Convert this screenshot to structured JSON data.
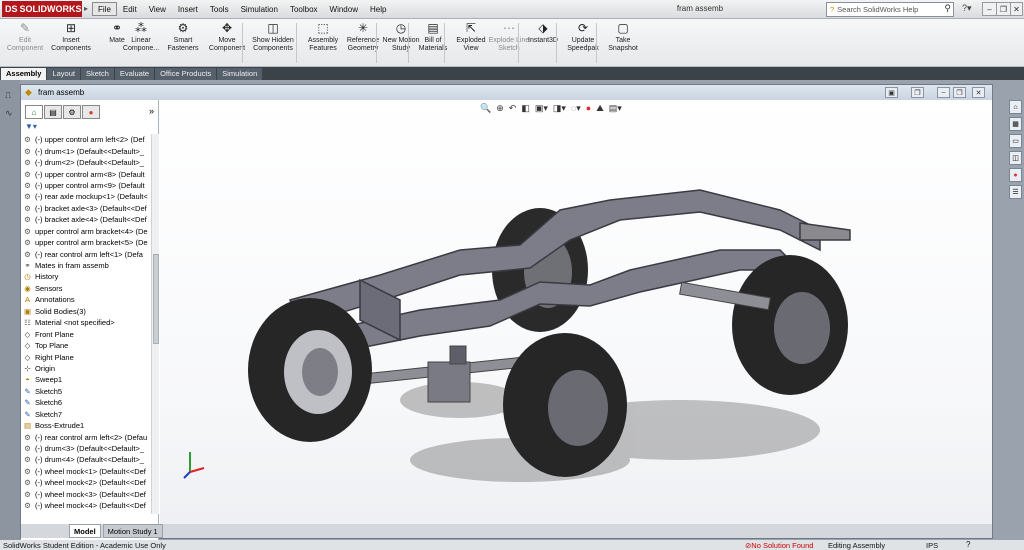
{
  "app": {
    "logo_text": "SOLIDWORKS",
    "logo_mark": "DS",
    "doc_title": "fram assemb"
  },
  "menu": [
    "File",
    "Edit",
    "View",
    "Insert",
    "Tools",
    "Simulation",
    "Toolbox",
    "Window",
    "Help"
  ],
  "search": {
    "placeholder": "Search SolidWorks Help"
  },
  "ribbon": [
    {
      "label": "Edit Component",
      "icon": "edit-component-icon",
      "disabled": true
    },
    {
      "label": "Insert Components",
      "icon": "insert-components-icon",
      "disabled": false
    },
    {
      "label": "Mate",
      "icon": "mate-icon",
      "disabled": false
    },
    {
      "label": "Linear Compone...",
      "icon": "linear-pattern-icon",
      "disabled": false
    },
    {
      "label": "Smart Fasteners",
      "icon": "smart-fasteners-icon",
      "disabled": false
    },
    {
      "label": "Move Component",
      "icon": "move-component-icon",
      "disabled": false
    },
    {
      "label": "Show Hidden Components",
      "icon": "show-hidden-icon",
      "disabled": false
    },
    {
      "label": "Assembly Features",
      "icon": "assembly-features-icon",
      "disabled": false
    },
    {
      "label": "Reference Geometry",
      "icon": "reference-geometry-icon",
      "disabled": false
    },
    {
      "label": "New Motion Study",
      "icon": "motion-study-icon",
      "disabled": false
    },
    {
      "label": "Bill of Materials",
      "icon": "bill-of-materials-icon",
      "disabled": false
    },
    {
      "label": "Exploded View",
      "icon": "exploded-view-icon",
      "disabled": false
    },
    {
      "label": "Explode Line Sketch",
      "icon": "explode-line-icon",
      "disabled": true
    },
    {
      "label": "Instant3D",
      "icon": "instant3d-icon",
      "disabled": false
    },
    {
      "label": "Update Speedpak",
      "icon": "speedpak-icon",
      "disabled": false
    },
    {
      "label": "Take Snapshot",
      "icon": "snapshot-icon",
      "disabled": false
    }
  ],
  "command_tabs": [
    "Assembly",
    "Layout",
    "Sketch",
    "Evaluate",
    "Office Products",
    "Simulation"
  ],
  "tree_items": [
    {
      "icon": "part-icon",
      "label": "(-) upper control arm left<2> (Def"
    },
    {
      "icon": "part-icon",
      "label": "(-) drum<1> (Default<<Default>_"
    },
    {
      "icon": "part-icon",
      "label": "(-) drum<2> (Default<<Default>_"
    },
    {
      "icon": "part-icon",
      "label": "(-) upper control arm<8> (Default"
    },
    {
      "icon": "part-icon",
      "label": "(-) upper control arm<9> (Default"
    },
    {
      "icon": "part-icon",
      "label": "(-) rear axle mockup<1> (Default<"
    },
    {
      "icon": "part-icon",
      "label": "(-) bracket axle<3> (Default<<Def"
    },
    {
      "icon": "part-icon",
      "label": "(-) bracket axle<4> (Default<<Def"
    },
    {
      "icon": "part-icon",
      "label": "upper control arm bracket<4> (De"
    },
    {
      "icon": "part-icon",
      "label": "upper control arm bracket<5> (De"
    },
    {
      "icon": "part-icon",
      "label": "(-) rear control arm left<1> (Defa"
    },
    {
      "icon": "mates-icon",
      "label": "Mates in fram assemb"
    },
    {
      "icon": "history-icon",
      "label": "History"
    },
    {
      "icon": "sensors-icon",
      "label": "Sensors"
    },
    {
      "icon": "annotations-icon",
      "label": "Annotations"
    },
    {
      "icon": "solid-bodies-icon",
      "label": "Solid Bodies(3)"
    },
    {
      "icon": "material-icon",
      "label": "Material <not specified>"
    },
    {
      "icon": "plane-icon",
      "label": "Front Plane"
    },
    {
      "icon": "plane-icon",
      "label": "Top Plane"
    },
    {
      "icon": "plane-icon",
      "label": "Right Plane"
    },
    {
      "icon": "origin-icon",
      "label": "Origin"
    },
    {
      "icon": "sweep-icon",
      "label": "Sweep1"
    },
    {
      "icon": "sketch-icon",
      "label": "Sketch5"
    },
    {
      "icon": "sketch-icon",
      "label": "Sketch6"
    },
    {
      "icon": "sketch-icon",
      "label": "Sketch7"
    },
    {
      "icon": "extrude-icon",
      "label": "Boss-Extrude1"
    },
    {
      "icon": "part-icon",
      "label": "(-) rear control arm left<2> (Defau"
    },
    {
      "icon": "part-icon",
      "label": "(-) drum<3> (Default<<Default>_"
    },
    {
      "icon": "part-icon",
      "label": "(-) drum<4> (Default<<Default>_"
    },
    {
      "icon": "part-icon",
      "label": "(-) wheel mock<1> (Default<<Def"
    },
    {
      "icon": "part-icon",
      "label": "(-) wheel mock<2> (Default<<Def"
    },
    {
      "icon": "part-icon",
      "label": "(-) wheel mock<3> (Default<<Def"
    },
    {
      "icon": "part-icon",
      "label": "(-) wheel mock<4> (Default<<Def"
    }
  ],
  "bottom_tabs": [
    "Model",
    "Motion Study 1"
  ],
  "status": {
    "left": "SolidWorks Student Edition - Academic Use Only",
    "no_solution": "No Solution Found",
    "mode": "Editing Assembly",
    "units": "IPS"
  }
}
